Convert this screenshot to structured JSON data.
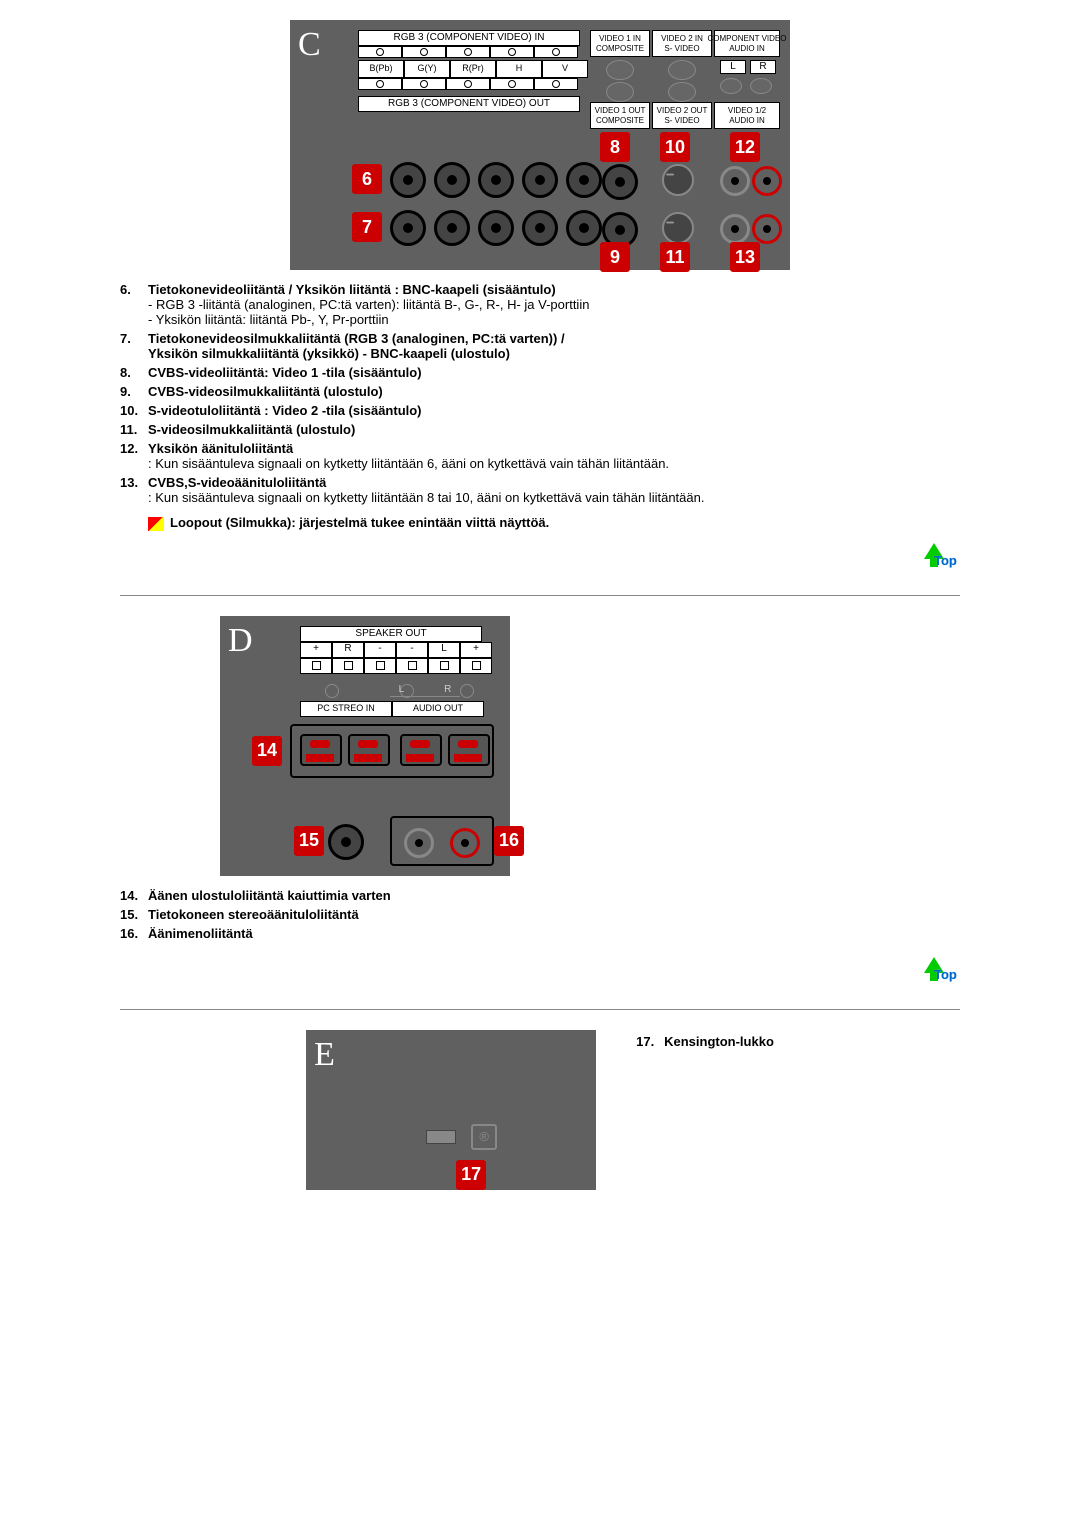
{
  "diagramC": {
    "letter": "C",
    "rgbInHeader": "RGB 3 (COMPONENT VIDEO) IN",
    "rgbOutHeader": "RGB 3 (COMPONENT VIDEO) OUT",
    "bncLabels": [
      "B(Pb)",
      "G(Y)",
      "R(Pr)",
      "H",
      "V"
    ],
    "col1": "VIDEO 1 IN\nCOMPOSITE",
    "col2": "VIDEO 2 IN\nS- VIDEO",
    "col3": "COMPONENT VIDEO\nAUDIO IN",
    "col1b": "VIDEO 1 OUT\nCOMPOSITE",
    "col2b": "VIDEO 2 OUT\nS- VIDEO",
    "col3b": "VIDEO 1/2\nAUDIO IN",
    "l": "L",
    "r": "R",
    "n6": "6",
    "n7": "7",
    "n8": "8",
    "n9": "9",
    "n10": "10",
    "n11": "11",
    "n12": "12",
    "n13": "13"
  },
  "listC": [
    {
      "n": "6.",
      "t": "Tietokonevideoliitäntä / Yksikön liitäntä : BNC-kaapeli (sisääntulo)",
      "d": [
        "- RGB 3 -liitäntä (analoginen, PC:tä varten): liitäntä B-, G-, R-, H- ja V-porttiin",
        "- Yksikön liitäntä: liitäntä Pb-, Y, Pr-porttiin"
      ]
    },
    {
      "n": "7.",
      "t": "Tietokonevideosilmukkaliitäntä (RGB 3 (analoginen, PC:tä varten)) /\nYksikön silmukkaliitäntä (yksikkö) - BNC-kaapeli (ulostulo)"
    },
    {
      "n": "8.",
      "t": "CVBS-videoliitäntä: Video 1 -tila (sisääntulo)"
    },
    {
      "n": "9.",
      "t": "CVBS-videosilmukkaliitäntä (ulostulo)"
    },
    {
      "n": "10.",
      "t": "S-videotuloliitäntä : Video 2 -tila (sisääntulo)"
    },
    {
      "n": "11.",
      "t": "S-videosilmukkaliitäntä (ulostulo)"
    },
    {
      "n": "12.",
      "t": "Yksikön äänituloliitäntä",
      "d": [
        ": Kun sisääntuleva signaali on kytketty liitäntään 6, ääni on kytkettävä vain tähän liitäntään."
      ]
    },
    {
      "n": "13.",
      "t": "CVBS,S-videoäänituloliitäntä",
      "d": [
        ": Kun sisääntuleva signaali on kytketty liitäntään 8 tai 10, ääni on kytkettävä vain tähän liitäntään."
      ]
    }
  ],
  "noteC": "Loopout (Silmukka): järjestelmä tukee enintään viittä näyttöä.",
  "topLabel": "Top",
  "diagramD": {
    "letter": "D",
    "spkHeader": "SPEAKER OUT",
    "spkCells": [
      "+",
      "R",
      "-",
      "-",
      "L",
      "+"
    ],
    "l": "L",
    "r": "R",
    "pcStreo": "PC STREO IN",
    "audioOut": "AUDIO OUT",
    "n14": "14",
    "n15": "15",
    "n16": "16"
  },
  "listD": [
    {
      "n": "14.",
      "t": "Äänen ulostuloliitäntä kaiuttimia varten"
    },
    {
      "n": "15.",
      "t": "Tietokoneen stereoäänituloliitäntä"
    },
    {
      "n": "16.",
      "t": "Äänimenoliitäntä"
    }
  ],
  "diagramE": {
    "letter": "E",
    "n17": "17"
  },
  "listE": [
    {
      "n": "17.",
      "t": "Kensington-lukko"
    }
  ]
}
